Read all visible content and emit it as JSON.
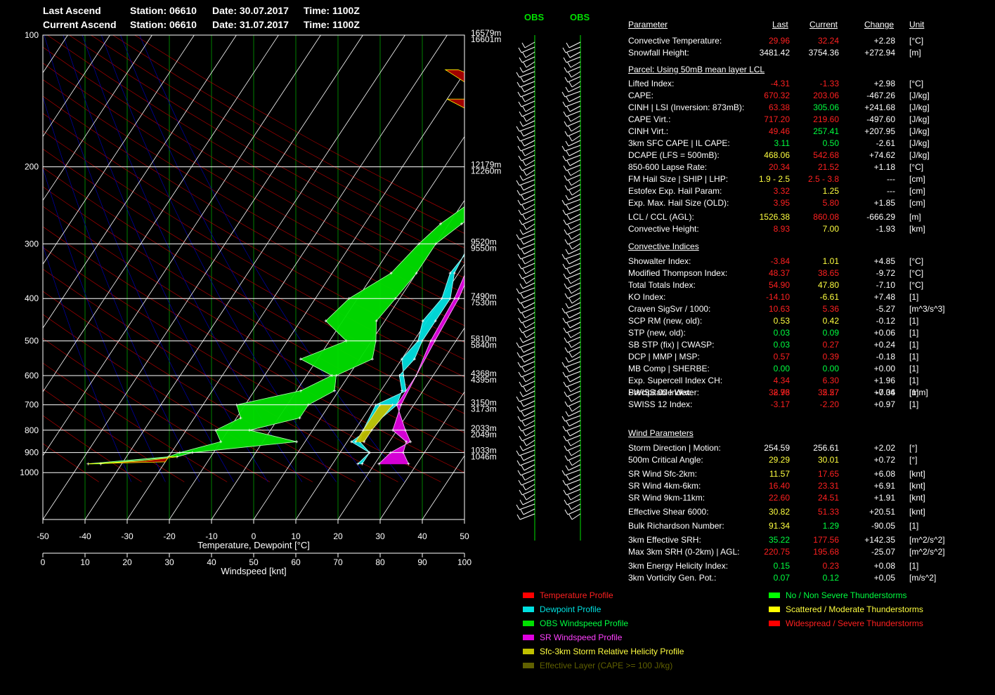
{
  "header": {
    "last_label": "Last Ascend",
    "current_label": "Current Ascend",
    "last_station": "Station: 06610",
    "current_station": "Station: 06610",
    "last_date": "Date: 30.07.2017",
    "current_date": "Date: 31.07.2017",
    "last_time": "Time: 1100Z",
    "current_time": "Time: 1100Z"
  },
  "obs_labels": [
    "OBS",
    "OBS"
  ],
  "colors": {
    "temperature": "#ff0000",
    "dewpoint": "#00e0e0",
    "obs_wind": "#00e000",
    "sr_wind": "#e000e0",
    "srh": "#c0c000",
    "effective_layer": "#606000",
    "grid": "#ffffff",
    "isotherm": "#00a000",
    "dry_adiabat": "#c00000",
    "moist_adiabat": "#0000c0",
    "red": "#ff2020",
    "yellow": "#ffff40",
    "green": "#00ff40",
    "white": "#ffffff"
  },
  "chart_data": {
    "type": "line",
    "title": "",
    "xlabel": "Temperature, Dewpoint  [°C]",
    "xlabel2": "Windspeed  [knt]",
    "xlim": [
      -50,
      50
    ],
    "x_ticks": [
      "-50",
      "-40",
      "-30",
      "-20",
      "-10",
      "0",
      "10",
      "20",
      "30",
      "40",
      "50"
    ],
    "x2lim": [
      0,
      100
    ],
    "x2_ticks": [
      "0",
      "10",
      "20",
      "30",
      "40",
      "50",
      "60",
      "70",
      "80",
      "90",
      "100"
    ],
    "ylabel": "",
    "y_log_scale": true,
    "ylim": [
      1000,
      100
    ],
    "y_ticks": [
      "100",
      "200",
      "300",
      "400",
      "500",
      "600",
      "700",
      "800",
      "900",
      "1000"
    ],
    "height_labels": [
      {
        "p": 100,
        "upper": "16579m",
        "lower": "16601m"
      },
      {
        "p": 200,
        "upper": "12179m",
        "lower": "12260m"
      },
      {
        "p": 300,
        "upper": "9520m",
        "lower": "9550m"
      },
      {
        "p": 400,
        "upper": "7490m",
        "lower": "7530m"
      },
      {
        "p": 500,
        "upper": "5810m",
        "lower": "5840m"
      },
      {
        "p": 600,
        "upper": "4368m",
        "lower": "4395m"
      },
      {
        "p": 700,
        "upper": "3150m",
        "lower": "3173m"
      },
      {
        "p": 800,
        "upper": "2033m",
        "lower": "2049m"
      },
      {
        "p": 900,
        "upper": "1033m",
        "lower": "1046m"
      }
    ],
    "series": [
      {
        "name": "Dewpoint Profile",
        "color_key": "dewpoint",
        "last": [
          [
            955,
            16
          ],
          [
            900,
            17
          ],
          [
            850,
            13
          ],
          [
            800,
            12
          ],
          [
            700,
            11
          ],
          [
            650,
            16
          ],
          [
            600,
            13
          ],
          [
            550,
            10
          ],
          [
            500,
            11
          ],
          [
            450,
            9
          ],
          [
            400,
            10
          ],
          [
            350,
            8
          ],
          [
            300,
            9
          ],
          [
            270,
            10
          ],
          [
            240,
            3
          ],
          [
            220,
            1
          ],
          [
            200,
            4
          ],
          [
            180,
            2
          ],
          [
            160,
            1
          ],
          [
            140,
            6
          ],
          [
            120,
            12
          ],
          [
            100,
            31
          ]
        ],
        "current": [
          [
            955,
            17
          ],
          [
            900,
            17
          ],
          [
            850,
            11
          ],
          [
            800,
            13
          ],
          [
            700,
            16
          ],
          [
            650,
            15
          ],
          [
            600,
            12
          ],
          [
            550,
            13
          ],
          [
            500,
            12
          ],
          [
            450,
            12
          ],
          [
            400,
            12
          ],
          [
            350,
            9
          ],
          [
            300,
            8
          ],
          [
            270,
            5
          ],
          [
            240,
            8
          ],
          [
            220,
            5
          ],
          [
            200,
            7
          ],
          [
            180,
            6
          ],
          [
            160,
            2
          ],
          [
            140,
            9
          ],
          [
            120,
            16
          ],
          [
            100,
            28
          ]
        ]
      },
      {
        "name": "SR Windspeed Profile",
        "color_key": "sr_wind",
        "last": [
          [
            955,
            21
          ],
          [
            900,
            22
          ],
          [
            850,
            25
          ],
          [
            800,
            22
          ],
          [
            700,
            16
          ],
          [
            600,
            16
          ],
          [
            500,
            14
          ],
          [
            400,
            13
          ],
          [
            300,
            10
          ],
          [
            250,
            10
          ],
          [
            200,
            11
          ],
          [
            180,
            18
          ],
          [
            160,
            27
          ],
          [
            140,
            33
          ],
          [
            120,
            40
          ],
          [
            100,
            49
          ]
        ],
        "current": [
          [
            955,
            28
          ],
          [
            900,
            25
          ],
          [
            850,
            24
          ],
          [
            800,
            19
          ],
          [
            700,
            17
          ],
          [
            600,
            16
          ],
          [
            500,
            15
          ],
          [
            400,
            14
          ],
          [
            300,
            11
          ],
          [
            250,
            11
          ],
          [
            200,
            13
          ],
          [
            180,
            19
          ],
          [
            160,
            30
          ],
          [
            140,
            37
          ],
          [
            120,
            44
          ],
          [
            100,
            52
          ]
        ]
      },
      {
        "name": "OBS Windspeed Profile",
        "color_key": "obs_wind",
        "last": [
          [
            955,
            -48
          ],
          [
            920,
            -30
          ],
          [
            900,
            -28
          ],
          [
            850,
            -20
          ],
          [
            800,
            -23
          ],
          [
            750,
            -19
          ],
          [
            700,
            -22
          ],
          [
            650,
            -9
          ],
          [
            600,
            -4
          ],
          [
            550,
            -14
          ],
          [
            500,
            -6
          ],
          [
            450,
            -14
          ],
          [
            400,
            -12
          ],
          [
            350,
            -6
          ],
          [
            300,
            -4
          ],
          [
            270,
            -2
          ],
          [
            200,
            8
          ],
          [
            180,
            6
          ],
          [
            160,
            8
          ],
          [
            140,
            -5
          ],
          [
            120,
            -20
          ],
          [
            105,
            -12
          ],
          [
            100,
            -15
          ]
        ],
        "current": [
          [
            955,
            -45
          ],
          [
            920,
            -28
          ],
          [
            900,
            -25
          ],
          [
            850,
            -2
          ],
          [
            800,
            -15
          ],
          [
            750,
            -5
          ],
          [
            700,
            -5
          ],
          [
            650,
            -1
          ],
          [
            600,
            -3
          ],
          [
            550,
            3
          ],
          [
            500,
            1
          ],
          [
            450,
            -2
          ],
          [
            400,
            -1
          ],
          [
            350,
            0
          ],
          [
            300,
            0
          ],
          [
            270,
            3
          ],
          [
            200,
            12
          ],
          [
            180,
            12
          ],
          [
            160,
            14
          ],
          [
            140,
            -3
          ],
          [
            120,
            -6
          ],
          [
            105,
            -5
          ],
          [
            100,
            -6
          ]
        ]
      },
      {
        "name": "Sfc-3km Storm Relative Helicity Profile",
        "color_key": "srh",
        "last": [
          [
            850,
            12
          ],
          [
            800,
            12
          ],
          [
            700,
            12
          ]
        ],
        "current": [
          [
            850,
            14
          ],
          [
            800,
            14
          ],
          [
            700,
            15
          ]
        ]
      }
    ]
  },
  "table": {
    "col_headers": {
      "param": "Parameter",
      "last": "Last",
      "current": "Current",
      "change": "Change",
      "unit": "Unit"
    },
    "rows_top": [
      {
        "label": "Convective Temperature:",
        "last": "29.96",
        "lc": "red",
        "current": "32.24",
        "cc": "red",
        "change": "+2.28",
        "unit": "[°C]"
      },
      {
        "label": "Snowfall Height:",
        "last": "3481.42",
        "lc": "white",
        "current": "3754.36",
        "cc": "white",
        "change": "+272.94",
        "unit": "[m]"
      }
    ],
    "parcel_title": "Parcel: Using 50mB mean layer LCL",
    "rows_parcel": [
      {
        "label": "Lifted Index:",
        "last": "-4.31",
        "lc": "red",
        "current": "-1.33",
        "cc": "red",
        "change": "+2.98",
        "unit": "[°C]"
      },
      {
        "label": "CAPE:",
        "last": "670.32",
        "lc": "red",
        "current": "203.06",
        "cc": "red",
        "change": "-467.26",
        "unit": "[J/kg]"
      },
      {
        "label": "CINH | LSI (Inversion: 873mB):",
        "last": "63.38",
        "lc": "red",
        "current": "305.06",
        "cc": "green",
        "change": "+241.68",
        "unit": "[J/kg]"
      },
      {
        "label": "CAPE Virt.:",
        "last": "717.20",
        "lc": "red",
        "current": "219.60",
        "cc": "red",
        "change": "-497.60",
        "unit": "[J/kg]"
      },
      {
        "label": "CINH Virt.:",
        "last": "49.46",
        "lc": "red",
        "current": "257.41",
        "cc": "green",
        "change": "+207.95",
        "unit": "[J/kg]"
      },
      {
        "label": "3km SFC CAPE | IL CAPE:",
        "last": "3.11",
        "lc": "green",
        "current": "0.50",
        "cc": "green",
        "change": "-2.61",
        "unit": "[J/kg]"
      },
      {
        "label": "DCAPE (LFS = 500mB):",
        "last": "468.06",
        "lc": "yellow",
        "current": "542.68",
        "cc": "red",
        "change": "+74.62",
        "unit": "[J/kg]"
      },
      {
        "label": "850-600 Lapse Rate:",
        "last": "20.34",
        "lc": "red",
        "current": "21.52",
        "cc": "red",
        "change": "+1.18",
        "unit": "[°C]"
      },
      {
        "label": "FM Hail Size | SHIP | LHP:",
        "last": "1.9 - 2.5",
        "lc": "yellow",
        "current": "2.5 - 3.8",
        "cc": "red",
        "change": "---",
        "unit": "[cm]"
      },
      {
        "label": "Estofex Exp. Hail Param:",
        "last": "3.32",
        "lc": "red",
        "current": "1.25",
        "cc": "yellow",
        "change": "---",
        "unit": "[cm]"
      },
      {
        "label": "Exp. Max. Hail Size (OLD):",
        "last": "3.95",
        "lc": "red",
        "current": "5.80",
        "cc": "red",
        "change": "+1.85",
        "unit": "[cm]"
      },
      {
        "label": "LCL / CCL (AGL):",
        "last": "1526.38",
        "lc": "yellow",
        "current": "860.08",
        "cc": "red",
        "change": "-666.29",
        "unit": "[m]"
      },
      {
        "label": "Convective Height:",
        "last": "8.93",
        "lc": "red",
        "current": "7.00",
        "cc": "yellow",
        "change": "-1.93",
        "unit": "[km]"
      }
    ],
    "conv_title": "Convective Indices",
    "rows_conv": [
      {
        "label": "Showalter Index:",
        "last": "-3.84",
        "lc": "red",
        "current": "1.01",
        "cc": "yellow",
        "change": "+4.85",
        "unit": "[°C]"
      },
      {
        "label": "Modified Thompson Index:",
        "last": "48.37",
        "lc": "red",
        "current": "38.65",
        "cc": "red",
        "change": "-9.72",
        "unit": "[°C]"
      },
      {
        "label": "Total Totals Index:",
        "last": "54.90",
        "lc": "red",
        "current": "47.80",
        "cc": "yellow",
        "change": "-7.10",
        "unit": "[°C]"
      },
      {
        "label": "KO Index:",
        "last": "-14.10",
        "lc": "red",
        "current": "-6.61",
        "cc": "yellow",
        "change": "+7.48",
        "unit": "[1]"
      },
      {
        "label": "Craven SigSvr / 1000:",
        "last": "10.63",
        "lc": "red",
        "current": "5.36",
        "cc": "red",
        "change": "-5.27",
        "unit": "[m^3/s^3]"
      },
      {
        "label": "SCP RM (new, old):",
        "last": "0.53",
        "lc": "yellow",
        "current": "0.42",
        "cc": "yellow",
        "change": "-0.12",
        "unit": "[1]"
      },
      {
        "label": "STP (new, old):",
        "last": "0.03",
        "lc": "green",
        "current": "0.09",
        "cc": "green",
        "change": "+0.06",
        "unit": "[1]"
      },
      {
        "label": "SB STP (fix) | CWASP:",
        "last": "0.03",
        "lc": "green",
        "current": "0.27",
        "cc": "red",
        "change": "+0.24",
        "unit": "[1]"
      },
      {
        "label": "DCP | MMP | MSP:",
        "last": "0.57",
        "lc": "red",
        "current": "0.39",
        "cc": "red",
        "change": "-0.18",
        "unit": "[1]"
      },
      {
        "label": "MB Comp | SHERBE:",
        "last": "0.00",
        "lc": "green",
        "current": "0.00",
        "cc": "green",
        "change": "+0.00",
        "unit": "[1]"
      },
      {
        "label": "Exp. Supercell Index CH:",
        "last": "4.34",
        "lc": "red",
        "current": "6.30",
        "cc": "red",
        "change": "+1.96",
        "unit": "[1]"
      },
      {
        "label": "SWISS 00 Index:",
        "last": "2.93",
        "lc": "red",
        "current": "2.57",
        "cc": "red",
        "change": "-0.36",
        "unit": "[1]"
      },
      {
        "label": "Precipitable Water:",
        "last": "38.76",
        "lc": "red",
        "current": "35.27",
        "cc": "red",
        "change": "+7.04",
        "unit": "[mm]"
      }
    ],
    "overlap_row": {
      "label": "SWISS 12 Index:",
      "last": "-3.17",
      "current": "-2.20",
      "change": "+0.97",
      "unit": "[1]"
    },
    "wind_title": "Wind Parameters",
    "rows_wind": [
      {
        "label": "Storm Direction | Motion:",
        "last": "254.59",
        "lc": "white",
        "current": "256.61",
        "cc": "white",
        "change": "+2.02",
        "unit": "[°]"
      },
      {
        "label": "500m Critical Angle:",
        "last": "29.29",
        "lc": "yellow",
        "current": "30.01",
        "cc": "yellow",
        "change": "+0.72",
        "unit": "[°]"
      },
      {
        "label": "SR Wind Sfc-2km:",
        "last": "11.57",
        "lc": "yellow",
        "current": "17.65",
        "cc": "red",
        "change": "+6.08",
        "unit": "[knt]"
      },
      {
        "label": "SR Wind 4km-6km:",
        "last": "16.40",
        "lc": "red",
        "current": "23.31",
        "cc": "red",
        "change": "+6.91",
        "unit": "[knt]"
      },
      {
        "label": "SR Wind 9km-11km:",
        "last": "22.60",
        "lc": "red",
        "current": "24.51",
        "cc": "red",
        "change": "+1.91",
        "unit": "[knt]"
      },
      {
        "label": "Effective Shear 6000:",
        "last": "30.82",
        "lc": "yellow",
        "current": "51.33",
        "cc": "red",
        "change": "+20.51",
        "unit": "[knt]"
      },
      {
        "label": "Bulk Richardson Number:",
        "last": "91.34",
        "lc": "yellow",
        "current": "1.29",
        "cc": "green",
        "change": "-90.05",
        "unit": "[1]"
      },
      {
        "label": "3km Effective SRH:",
        "last": "35.22",
        "lc": "green",
        "current": "177.56",
        "cc": "red",
        "change": "+142.35",
        "unit": "[m^2/s^2]"
      },
      {
        "label": "Max 3km SRH (0-2km) | AGL:",
        "last": "220.75",
        "lc": "red",
        "current": "195.68",
        "cc": "red",
        "change": "-25.07",
        "unit": "[m^2/s^2]"
      },
      {
        "label": "3km Energy Helicity Index:",
        "last": "0.15",
        "lc": "green",
        "current": "0.23",
        "cc": "red",
        "change": "+0.08",
        "unit": "[1]"
      },
      {
        "label": "3km Vorticity Gen. Pot.:",
        "last": "0.07",
        "lc": "green",
        "current": "0.12",
        "cc": "green",
        "change": "+0.05",
        "unit": "[m/s^2]"
      }
    ]
  },
  "legend_left": [
    {
      "label": "Temperature Profile",
      "color": "#ff0000",
      "text_color": "#ff2020"
    },
    {
      "label": "Dewpoint Profile",
      "color": "#00e0e0",
      "text_color": "#00e0e0"
    },
    {
      "label": "OBS Windspeed Profile",
      "color": "#00e000",
      "text_color": "#00ff40"
    },
    {
      "label": "SR Windspeed Profile",
      "color": "#e000e0",
      "text_color": "#ff40ff"
    },
    {
      "label": "Sfc-3km Storm Relative Helicity Profile",
      "color": "#c0c000",
      "text_color": "#ffff40"
    },
    {
      "label": "Effective Layer (CAPE >= 100 J/kg)",
      "color": "#606000",
      "text_color": "#606000"
    }
  ],
  "legend_right": [
    {
      "label": "No / Non Severe Thunderstorms",
      "color": "#00ff00",
      "text_color": "#00ff40"
    },
    {
      "label": "Scattered / Moderate Thunderstorms",
      "color": "#ffff00",
      "text_color": "#ffff40"
    },
    {
      "label": "Widespread / Severe Thunderstorms",
      "color": "#ff0000",
      "text_color": "#ff2020"
    }
  ]
}
